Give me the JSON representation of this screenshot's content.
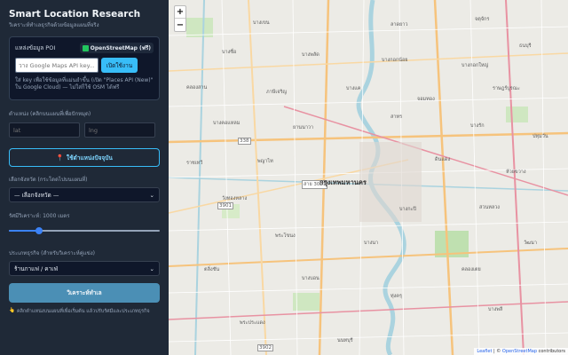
{
  "sidebar": {
    "title": "Smart Location Research",
    "subtitle": "วิเคราะห์ทำเลธุรกิจด้วยข้อมูลแผนที่จริง",
    "poi": {
      "label": "แหล่งข้อมูล POI",
      "badge": "OpenStreetMap (ฟรี)",
      "key_placeholder": "วาง Google Maps API key...",
      "enable_label": "เปิดใช้งาน",
      "note": "ใส่ key เพื่อใช้ข้อมูลที่แม่นยำขึ้น (เปิด \"Places API (New)\" ใน Google Cloud) — ไม่ใส่ก็ใช้ OSM ได้ฟรี"
    },
    "coords": {
      "label": "ตำแหน่ง (คลิกบนแผนที่เพื่อปักหมุด)",
      "lat_placeholder": "lat",
      "lng_placeholder": "lng"
    },
    "current_location_label": "ใช้ตำแหน่งปัจจุบัน",
    "province": {
      "label": "เลือกจังหวัด (กระโดดไปบนแผนที่)",
      "selected": "— เลือกจังหวัด —"
    },
    "radius": {
      "label": "รัศมีวิเคราะห์: 1000 เมตร",
      "value_fraction": 0.2
    },
    "category": {
      "label": "ประเภทธุรกิจ (สำหรับวิเคราะห์คู่แข่ง)",
      "selected": "ร้านกาแฟ / คาเฟ่"
    },
    "analyze_label": "วิเคราะห์ทำเล",
    "hint": "คลิกตำแหน่งบนแผนที่เพื่อเริ่มต้น แล้วปรับรัศมีและประเภทธุรกิจ"
  },
  "map": {
    "zoom_in": "+",
    "zoom_out": "−",
    "city_label": "กรุงเทพมหานคร",
    "labels": [
      "บางเขน",
      "ลาดยาว",
      "จตุจักร",
      "บางซื่อ",
      "บางพลัด",
      "บางกอกน้อย",
      "บางกอกใหญ่",
      "ธนบุรี",
      "คลองสาน",
      "ภาษีเจริญ",
      "บางแค",
      "จอมทอง",
      "ราษฎร์บูรณะ",
      "บางคอแหลม",
      "ยานนาวา",
      "สาทร",
      "บางรัก",
      "ปทุมวัน",
      "ราชเทวี",
      "พญาไท",
      "ดินแดง",
      "ห้วยขวาง",
      "วังทองหลาง",
      "บางกะปิ",
      "สวนหลวง",
      "พระโขนง",
      "บางนา",
      "คลองเตย",
      "วัฒนา",
      "ตลิ่งชัน",
      "บางบอน",
      "ทุ่งครุ",
      "บางพลี",
      "พระประแดง",
      "นนทบุรี"
    ],
    "route_labels": [
      "338",
      "3901",
      "สาย 3021",
      "3902"
    ],
    "attribution": {
      "leaflet": "Leaflet",
      "sep": " | © ",
      "osm": "OpenStreetMap",
      "suffix": " contributors"
    }
  }
}
